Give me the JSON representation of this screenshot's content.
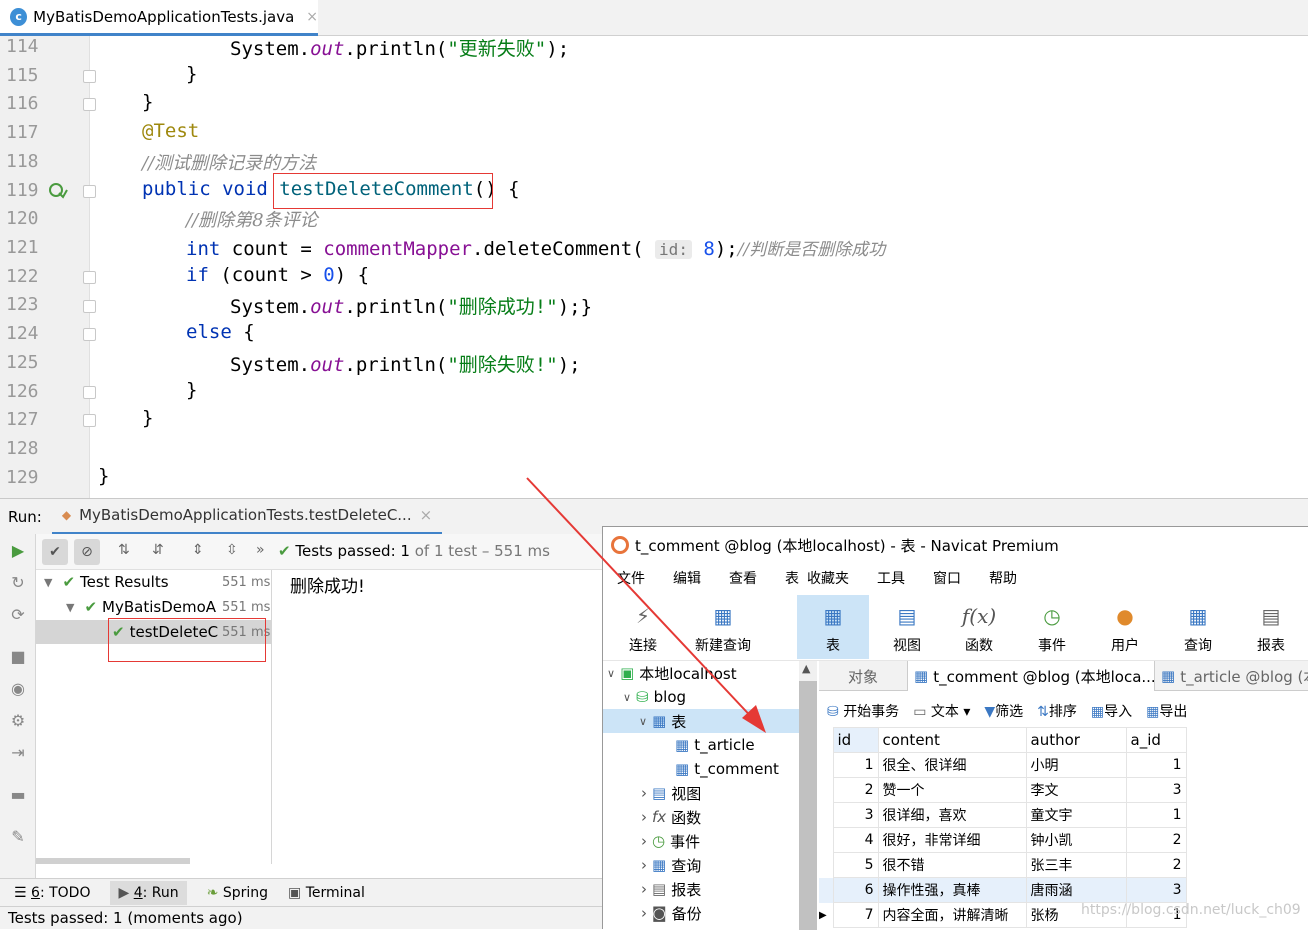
{
  "editor_tab": {
    "filename": "MyBatisDemoApplicationTests.java",
    "close": "×",
    "icon": "c"
  },
  "code_lines": [
    {
      "n": "114"
    },
    {
      "n": "115"
    },
    {
      "n": "116"
    },
    {
      "n": "117"
    },
    {
      "n": "118"
    },
    {
      "n": "119"
    },
    {
      "n": "120"
    },
    {
      "n": "121"
    },
    {
      "n": "122"
    },
    {
      "n": "123"
    },
    {
      "n": "124"
    },
    {
      "n": "125"
    },
    {
      "n": "126"
    },
    {
      "n": "127"
    },
    {
      "n": "128"
    },
    {
      "n": "129"
    }
  ],
  "code": {
    "l114_a": "System.",
    "l114_b": "out",
    "l114_c": ".println(",
    "l114_d": "\"更新失败\"",
    "l114_e": ");",
    "l115": "}",
    "l116": "}",
    "l117": "@Test",
    "l118": "//测试删除记录的方法",
    "l119_kw": "public void ",
    "l119_m": "testDeleteComment",
    "l119_p": "()",
    "l119_b": " {",
    "l120": "//删除第8条评论",
    "l121_kw": "int",
    "l121_a": " count = ",
    "l121_obj": "commentMapper",
    "l121_b": ".deleteComment(",
    "l121_hint": "id:",
    "l121_num": "8",
    "l121_c": ");",
    "l121_cmt": "//判断是否删除成功",
    "l122_kw": "if",
    "l122_a": " (count > ",
    "l122_num": "0",
    "l122_b": ") {",
    "l123_a": "System.",
    "l123_b": "out",
    "l123_c": ".println(",
    "l123_d": "\"删除成功!\"",
    "l123_e": ");}",
    "l124_kw": "else",
    "l124_b": " {",
    "l125_a": "System.",
    "l125_b": "out",
    "l125_c": ".println(",
    "l125_d": "\"删除失败!\"",
    "l125_e": ");",
    "l126": "}",
    "l127": "}",
    "l129": "}"
  },
  "run": {
    "label": "Run:",
    "tab": "MyBatisDemoApplicationTests.testDeleteC...",
    "tab_close": "×",
    "status_prefix": "Tests passed:",
    "status_count": "1",
    "status_suffix": "of 1 test – 551 ms",
    "more": "»",
    "tree": [
      {
        "label": "Test Results",
        "ms": "551 ms"
      },
      {
        "label": "MyBatisDemoA",
        "ms": "551 ms"
      },
      {
        "label": "testDeleteC",
        "ms": "551 ms"
      }
    ],
    "console_output": "删除成功!"
  },
  "bottom_tabs": [
    {
      "key": "6",
      "label": ": TODO"
    },
    {
      "key": "4",
      "label": ": Run"
    },
    {
      "label": "Spring"
    },
    {
      "label": "Terminal"
    }
  ],
  "statusbar": "Tests passed: 1 (moments ago)",
  "navicat": {
    "title": "t_comment @blog (本地localhost) - 表 - Navicat Premium",
    "menu": [
      "文件",
      "编辑",
      "查看",
      "表",
      "收藏夹",
      "工具",
      "窗口",
      "帮助"
    ],
    "ribbon": [
      "连接",
      "新建查询",
      "表",
      "视图",
      "函数",
      "事件",
      "用户",
      "查询",
      "报表"
    ],
    "tree": [
      {
        "label": "本地localhost"
      },
      {
        "label": "blog"
      },
      {
        "label": "表"
      },
      {
        "label": "t_article"
      },
      {
        "label": "t_comment"
      },
      {
        "label": "视图"
      },
      {
        "label": "函数"
      },
      {
        "label": "事件"
      },
      {
        "label": "查询"
      },
      {
        "label": "报表"
      },
      {
        "label": "备份"
      }
    ],
    "tabs": [
      "对象",
      "t_comment @blog (本地loca...",
      "t_article @blog (本"
    ],
    "toolbar": [
      "开始事务",
      "文本",
      "筛选",
      "排序",
      "导入",
      "导出"
    ],
    "columns": [
      "id",
      "content",
      "author",
      "a_id"
    ],
    "rows": [
      [
        "1",
        "很全、很详细",
        "小明",
        "1"
      ],
      [
        "2",
        "赞一个",
        "李文",
        "3"
      ],
      [
        "3",
        "很详细，喜欢",
        "童文宇",
        "1"
      ],
      [
        "4",
        "很好，非常详细",
        "钟小凯",
        "2"
      ],
      [
        "5",
        "很不错",
        "张三丰",
        "2"
      ],
      [
        "6",
        "操作性强，真棒",
        "唐雨涵",
        "3"
      ],
      [
        "7",
        "内容全面，讲解清晰",
        "张杨",
        "1"
      ]
    ],
    "watermark": "https://blog.csdn.net/luck_ch09"
  },
  "colors": {
    "accent": "#4083c9",
    "check": "#4a9b3f",
    "annotation_red": "#e53935"
  }
}
